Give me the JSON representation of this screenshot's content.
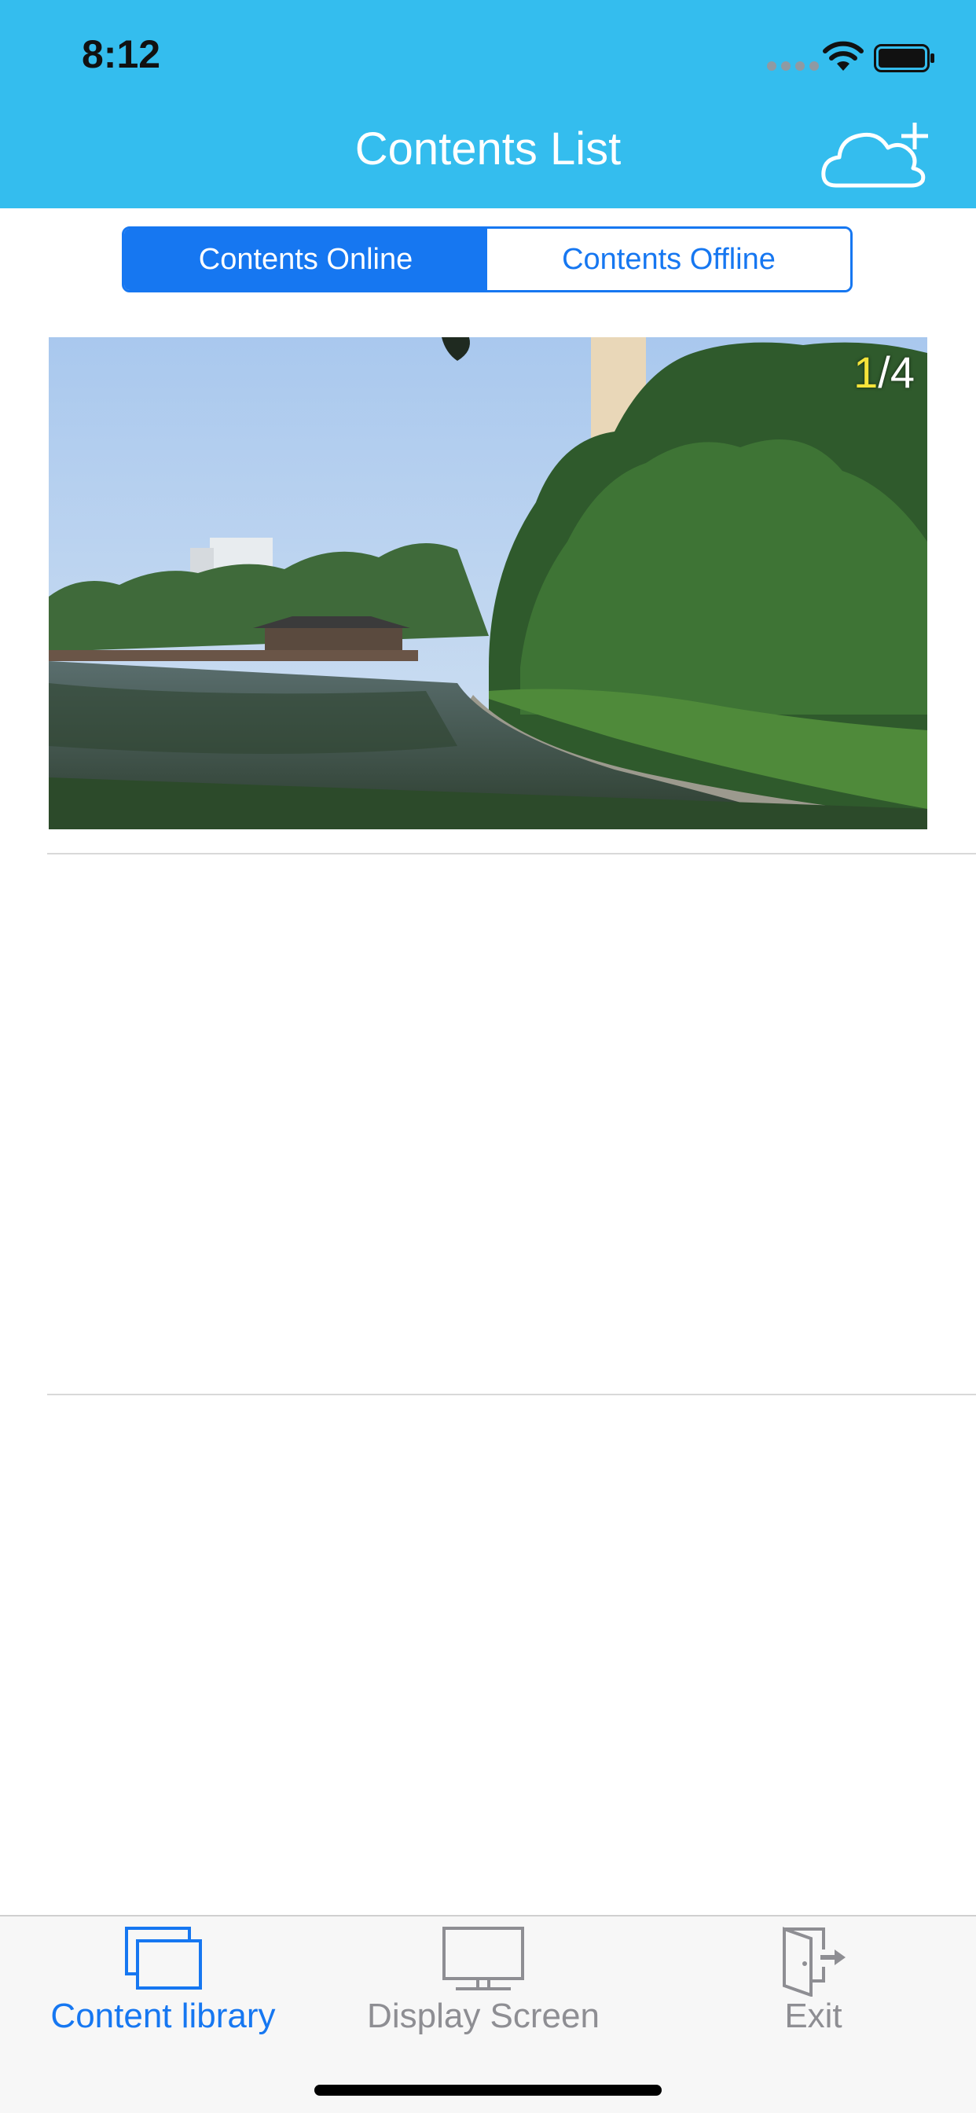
{
  "status_bar": {
    "time": "8:12"
  },
  "nav": {
    "title": "Contents List",
    "action_icon": "cloud-add-icon"
  },
  "segmented": {
    "options": [
      "Contents Online",
      "Contents Offline"
    ],
    "selected": "Contents Online"
  },
  "content": {
    "items": [
      {
        "image_description_icon": "photo",
        "counter_current": "1",
        "counter_total": "/4"
      }
    ]
  },
  "tabbar": {
    "tabs": [
      {
        "label": "Content library",
        "icon": "content-library-icon",
        "active": true
      },
      {
        "label": "Display Screen",
        "icon": "monitor-icon",
        "active": false
      },
      {
        "label": "Exit",
        "icon": "exit-door-icon",
        "active": false
      }
    ]
  },
  "colors": {
    "header": "#34bdee",
    "accent": "#1677f1",
    "inactive_tab": "#8e8e93",
    "counter_highlight": "#f5e43a"
  }
}
